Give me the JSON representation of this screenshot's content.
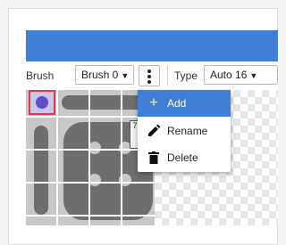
{
  "toolbar": {
    "brush_label": "Brush",
    "brush_value": "Brush 0",
    "type_label": "Type",
    "type_value": "Auto 16"
  },
  "menu": {
    "items": [
      {
        "label": "Add",
        "icon": "plus-icon"
      },
      {
        "label": "Rename",
        "icon": "pencil-icon"
      },
      {
        "label": "Delete",
        "icon": "trash-icon"
      }
    ]
  },
  "canvas": {
    "tile_number": "7"
  },
  "colors": {
    "accent": "#3f7fd6",
    "selection_border": "#e03a4a",
    "selected_tile_fill": "#5b4fc4",
    "tile_shape": "#6e6e6e"
  }
}
